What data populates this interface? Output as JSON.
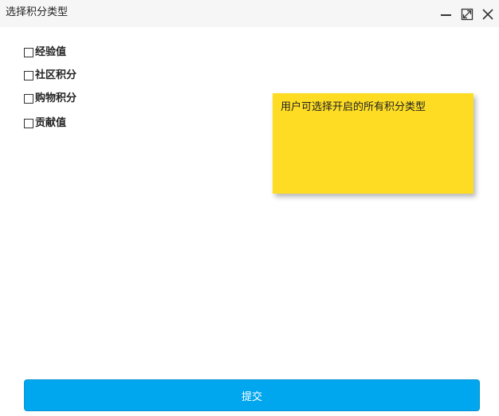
{
  "window": {
    "title": "选择积分类型"
  },
  "options": [
    {
      "label": "经验值",
      "checked": false
    },
    {
      "label": "社区积分",
      "checked": false
    },
    {
      "label": "购物积分",
      "checked": false
    },
    {
      "label": "贡献值",
      "checked": false
    }
  ],
  "note": {
    "text": "用户可选择开启的所有积分类型",
    "color": "#fddc23"
  },
  "submit": {
    "label": "提交",
    "color": "#00a7ef"
  },
  "icons": {
    "minimize": "minimize-icon",
    "maximize": "maximize-icon",
    "close": "close-icon"
  }
}
